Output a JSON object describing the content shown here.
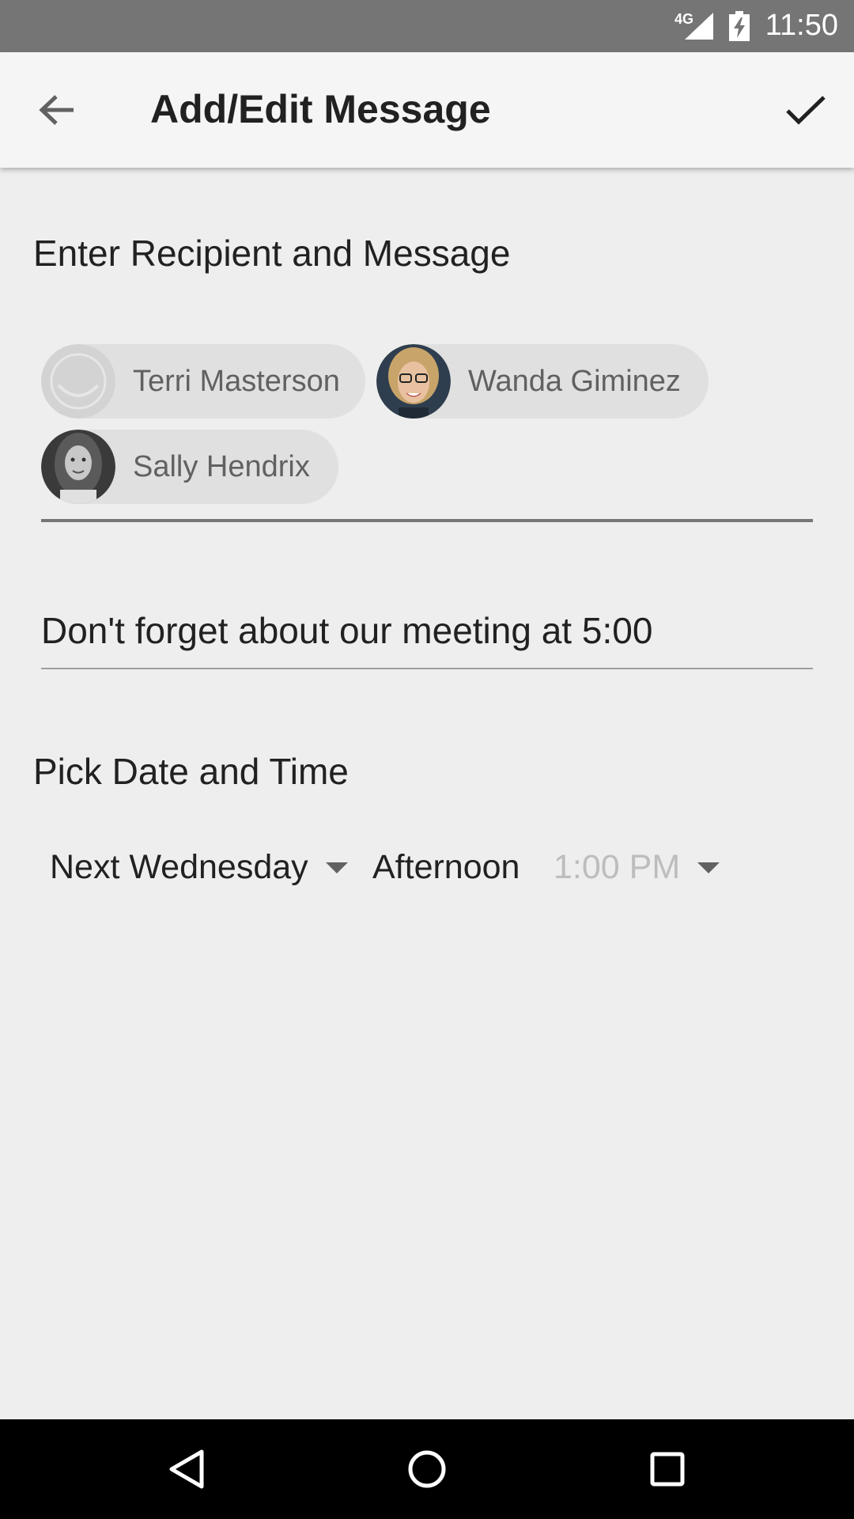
{
  "status_bar": {
    "network": "4G",
    "time": "11:50"
  },
  "app_bar": {
    "title": "Add/Edit Message",
    "icons": {
      "back": "arrow-back-icon",
      "confirm": "check-icon"
    }
  },
  "recipients": {
    "heading": "Enter Recipient and Message",
    "chips": [
      {
        "name": "Terri Masterson",
        "avatar": "default-avatar-icon"
      },
      {
        "name": "Wanda Giminez",
        "avatar": "photo"
      },
      {
        "name": "Sally Hendrix",
        "avatar": "photo"
      }
    ]
  },
  "message": {
    "value": "Don't forget about our meeting at 5:00"
  },
  "datetime": {
    "heading": "Pick Date and Time",
    "date_value": "Next Wednesday",
    "period_value": "Afternoon",
    "time_value": "1:00 PM"
  },
  "nav_bar": {
    "icons": [
      "nav-back-icon",
      "nav-home-icon",
      "nav-recents-icon"
    ]
  },
  "colors": {
    "status_bar": "#757575",
    "app_bar": "#f5f5f5",
    "background": "#eeeeee",
    "chip": "#e0e0e0",
    "nav_bar": "#000000"
  }
}
